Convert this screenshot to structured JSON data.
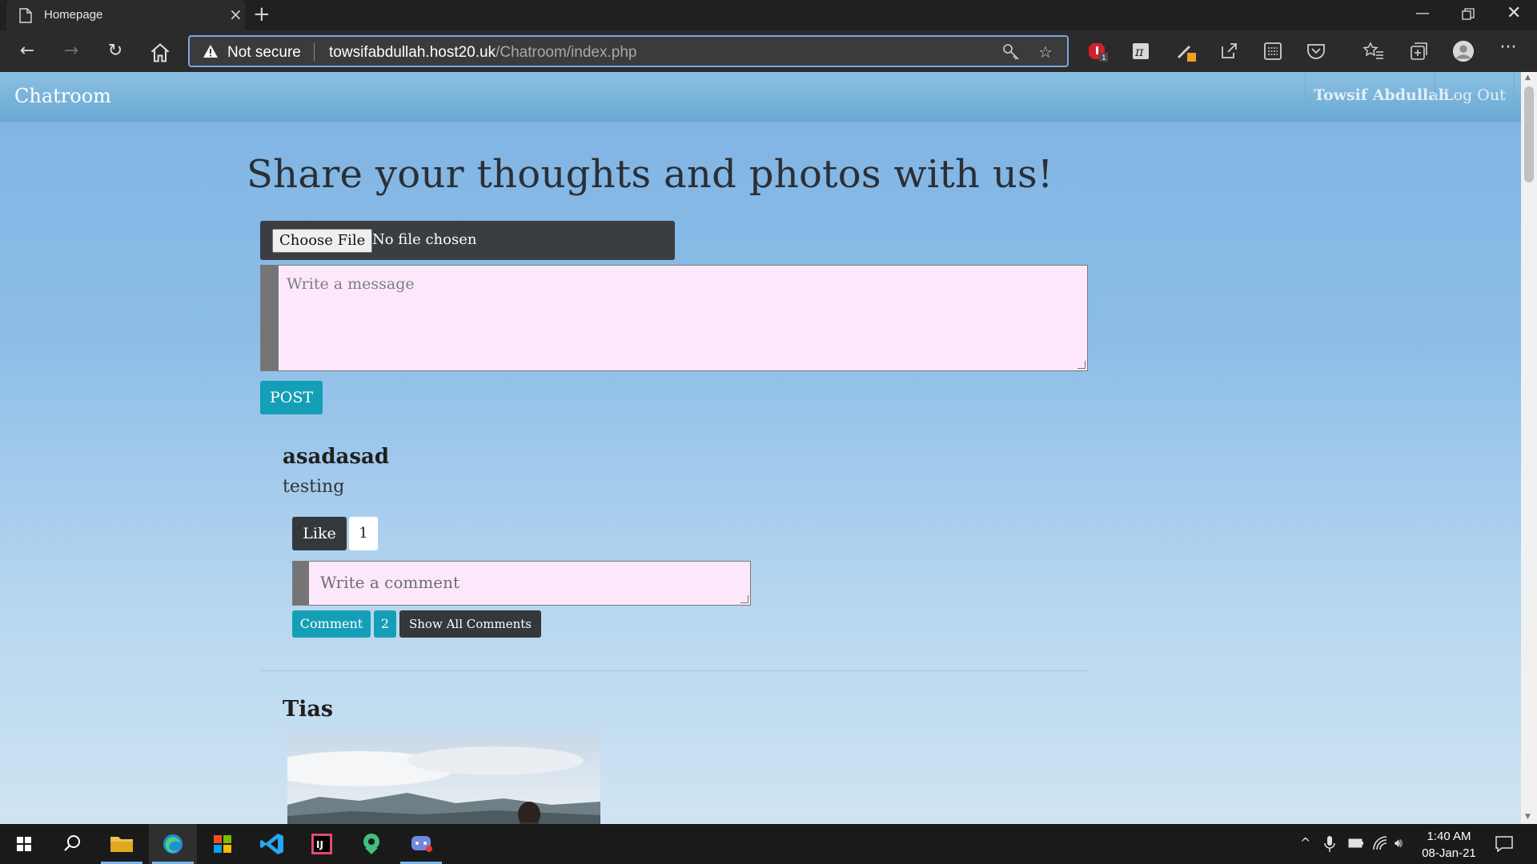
{
  "browser": {
    "tab_title": "Homepage",
    "security_label": "Not secure",
    "url_host": "towsifabdullah.host20.uk",
    "url_path": "/Chatroom/index.php"
  },
  "navbar": {
    "brand": "Chatroom",
    "user_name": "Towsif Abdullah",
    "logout_label": "Log Out"
  },
  "composer": {
    "headline": "Share your thoughts and photos with us!",
    "choose_file_label": "Choose File",
    "no_file_text": "No file chosen",
    "message_placeholder": "Write a message",
    "post_label": "POST"
  },
  "posts": [
    {
      "author": "asadasad",
      "text": "testing",
      "like_label": "Like",
      "like_count": "1",
      "comment_placeholder": "Write a comment",
      "comment_label": "Comment",
      "comment_count": "2",
      "show_all_label": "Show All Comments"
    },
    {
      "author": "Tias"
    }
  ],
  "taskbar": {
    "time": "1:40 AM",
    "date": "08-Jan-21"
  },
  "colors": {
    "accent_teal": "#159fb7",
    "dark_button": "#33383d",
    "input_pink": "#fde8fb"
  }
}
